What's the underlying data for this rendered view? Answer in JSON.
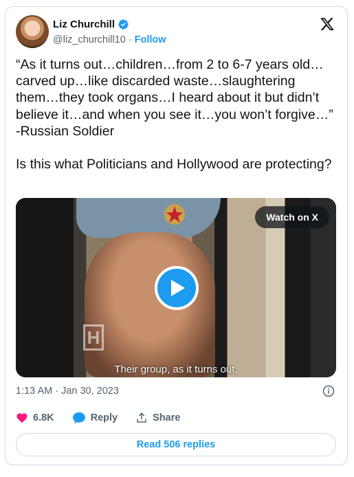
{
  "author": {
    "name": "Liz Churchill",
    "handle": "@liz_churchill10",
    "separator": "·",
    "follow_label": "Follow"
  },
  "tweet": {
    "text": "“As it turns out…children…from 2 to 6-7 years old…carved up…like discarded waste…slaughtering them…they took organs…I heard about it but didn’t believe it…and when you see it…you won’t forgive…” -Russian Soldier\n\nIs this what Politicians and Hollywood are protecting?",
    "timestamp": "1:13 AM · Jan 30, 2023"
  },
  "media": {
    "watch_label": "Watch on X",
    "subtitle": "Their group, as it turns out,",
    "watermark": "H"
  },
  "actions": {
    "likes": "6.8K",
    "reply_label": "Reply",
    "share_label": "Share"
  },
  "replies_button": "Read 506 replies",
  "colors": {
    "accent": "#1d9bf0",
    "like": "#f91880",
    "muted": "#536471"
  },
  "icons": [
    "verified-badge-icon",
    "x-logo-icon",
    "play-icon",
    "info-icon",
    "heart-icon",
    "reply-bubble-icon",
    "share-icon"
  ]
}
